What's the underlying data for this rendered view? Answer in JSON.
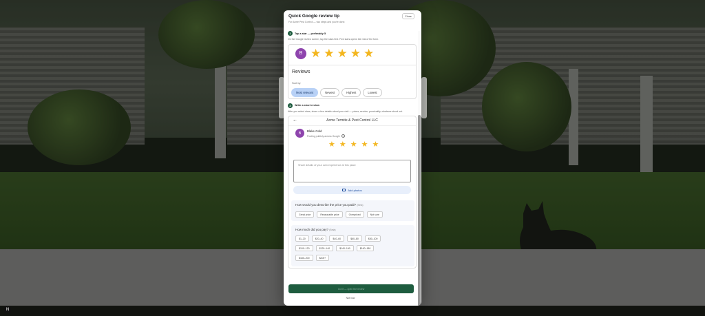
{
  "modal": {
    "title": "Quick Google review tip",
    "subtitle": "For Acme Pest Control — two steps and you're done.",
    "close_label": "Close"
  },
  "step1": {
    "number": "1",
    "title": "Tap a star — preferably 5",
    "description": "On the Google review screen, tap the stars first. Five stars opens the rest of the form.",
    "avatar_letter": "B",
    "stars": 5,
    "reviews_heading": "Reviews",
    "sort_by_label": "Sort by",
    "sort_options": [
      "Most relevant",
      "Newest",
      "Highest",
      "Lowest"
    ],
    "sort_selected": "Most relevant"
  },
  "step2": {
    "number": "2",
    "title": "Write a short review",
    "description": "After you select stars, share a few details about your visit — prices, service, punctuality, whatever stood out.",
    "business_name": "Acme Termite & Pest Control LLC",
    "user_name": "Blake Gold",
    "user_note": "Posting publicly across Google",
    "avatar_letter": "B",
    "stars": 5,
    "textarea_placeholder": "Share details of your own experience at this place",
    "add_photos_label": "Add photos",
    "price_question": "How would you describe the price you paid?",
    "price_tag": "(Beta)",
    "price_options": [
      "Great price",
      "Reasonable price",
      "Overpriced",
      "Not sure"
    ],
    "paid_question": "How much did you pay?",
    "paid_tag": "(Beta)",
    "paid_options_row1": [
      "$1–20",
      "$20–40",
      "$40–60",
      "$60–80",
      "$80–100"
    ],
    "paid_options_row2": [
      "$100–120",
      "$120–140",
      "$140–160",
      "$160–180"
    ],
    "paid_options_row3": [
      "$180–200",
      "$200+"
    ]
  },
  "footer": {
    "submit_label": "Got it — open the review",
    "not_now_label": "Not now"
  },
  "badge": "N",
  "colors": {
    "primary": "#1e5c3f",
    "star": "#f3b61f",
    "chip_active": "#b8d1f6",
    "avatar": "#8e44ad"
  }
}
